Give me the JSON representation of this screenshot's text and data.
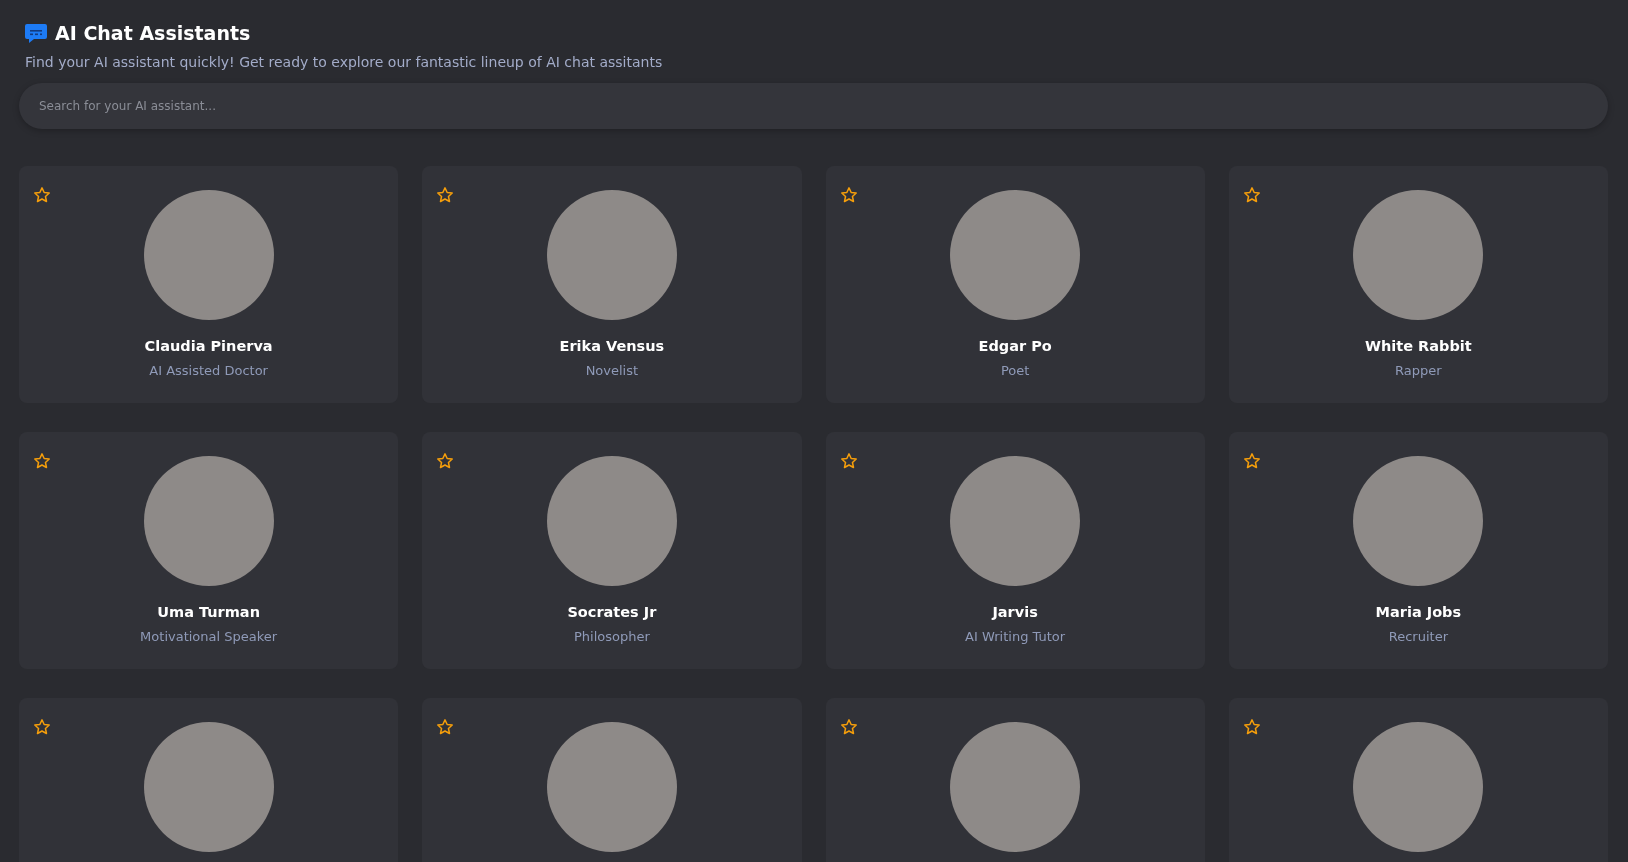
{
  "header": {
    "title": "AI Chat Assistants",
    "subtitle": "Find your AI assistant quickly! Get ready to explore our fantastic lineup of AI chat assitants"
  },
  "search": {
    "placeholder": "Search for your AI assistant..."
  },
  "cards": [
    {
      "name": "Claudia Pinerva",
      "role": "AI Assisted Doctor",
      "favorite": false
    },
    {
      "name": "Erika Vensus",
      "role": "Novelist",
      "favorite": false
    },
    {
      "name": "Edgar Po",
      "role": "Poet",
      "favorite": false
    },
    {
      "name": "White Rabbit",
      "role": "Rapper",
      "favorite": false
    },
    {
      "name": "Uma Turman",
      "role": "Motivational Speaker",
      "favorite": false
    },
    {
      "name": "Socrates Jr",
      "role": "Philosopher",
      "favorite": false
    },
    {
      "name": "Jarvis",
      "role": "AI Writing Tutor",
      "favorite": false
    },
    {
      "name": "Maria Jobs",
      "role": "Recruiter",
      "favorite": false
    },
    {
      "favorite": false
    },
    {
      "favorite": false
    },
    {
      "favorite": false
    },
    {
      "favorite": false
    }
  ]
}
